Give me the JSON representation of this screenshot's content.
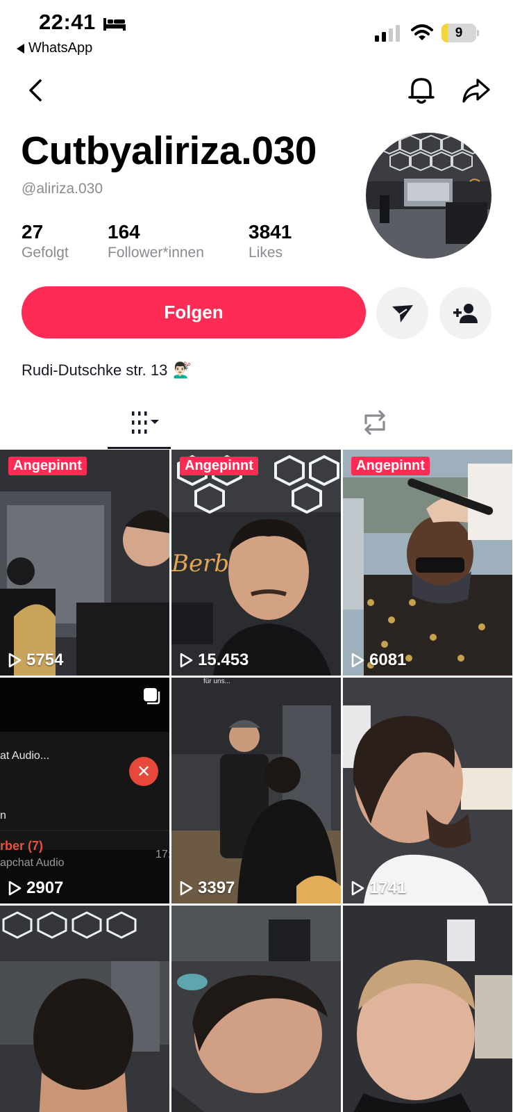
{
  "status_bar": {
    "time": "22:41",
    "back_app": "WhatsApp",
    "battery_level": "9"
  },
  "profile": {
    "display_name": "Cutbyaliriza.030",
    "handle": "@aliriza.030",
    "bio": "Rudi-Dutschke str. 13",
    "bio_emoji": "💇🏻‍♂️",
    "stats": [
      {
        "value": "27",
        "label": "Gefolgt"
      },
      {
        "value": "164",
        "label": "Follower*innen"
      },
      {
        "value": "3841",
        "label": "Likes"
      }
    ],
    "follow_label": "Folgen"
  },
  "icons": {
    "nav": [
      "back-chevron-icon",
      "bell-icon",
      "share-arrow-icon"
    ],
    "actions": [
      "send-message-icon",
      "add-friend-icon"
    ],
    "tabs": [
      "videos-grid-icon",
      "reposts-icon"
    ]
  },
  "colors": {
    "accent": "#fe2c55",
    "muted_text": "#8a8b91",
    "button_gray": "#f1f1f2"
  },
  "videos": [
    {
      "pinned": "Angepinnt",
      "views": "5754"
    },
    {
      "pinned": "Angepinnt",
      "views": "15.453"
    },
    {
      "pinned": "Angepinnt",
      "views": "6081"
    },
    {
      "pinned": "",
      "views": "2907",
      "overlay": {
        "line1": "at Audio...",
        "line2": "n",
        "line3": "rber (7)",
        "line4": "apchat Audio",
        "time": "17:"
      }
    },
    {
      "pinned": "",
      "views": "3397",
      "caption": "für uns..."
    },
    {
      "pinned": "",
      "views": "1741"
    },
    {
      "pinned": "",
      "views": ""
    },
    {
      "pinned": "",
      "views": ""
    },
    {
      "pinned": "",
      "views": ""
    }
  ]
}
